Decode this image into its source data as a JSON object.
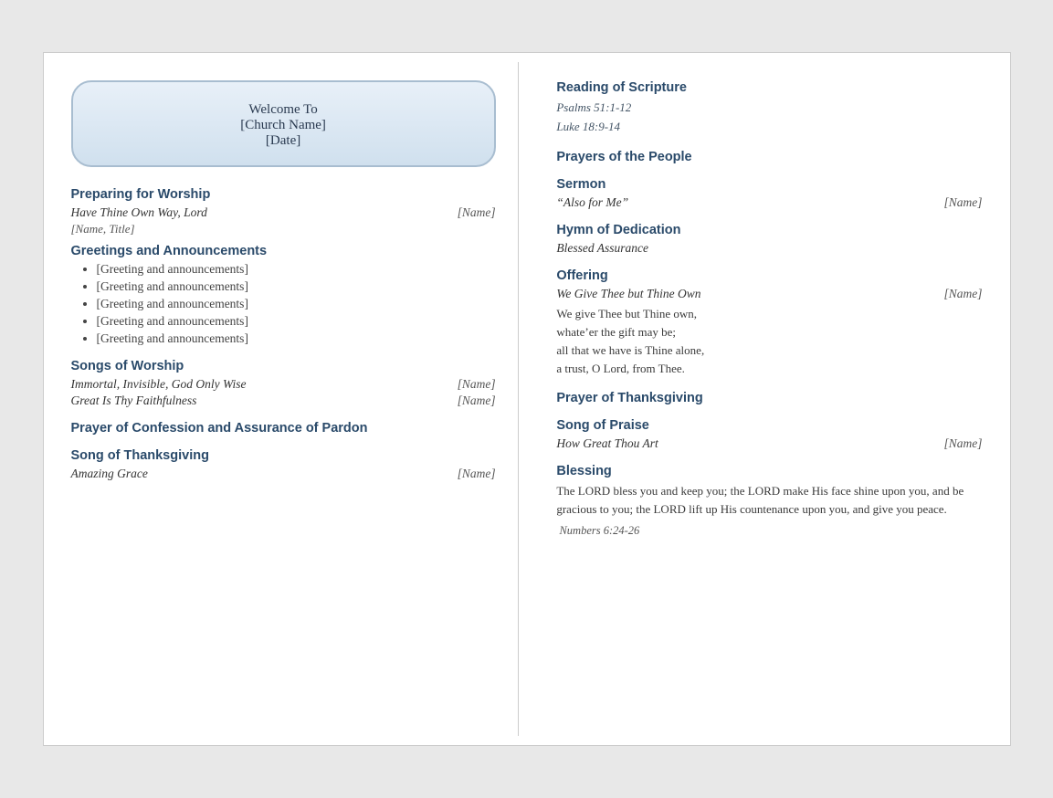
{
  "welcome": {
    "line1": "Welcome To",
    "line2": "[Church Name]",
    "line3": "[Date]"
  },
  "left": {
    "sections": [
      {
        "id": "preparing",
        "title": "Preparing for Worship",
        "items": [
          {
            "song": "Have Thine Own Way, Lord",
            "name": "[Name]"
          }
        ],
        "subtitle": "[Name, Title]"
      },
      {
        "id": "greetings",
        "title": "Greetings and Announcements",
        "bullets": [
          "[Greeting and announcements]",
          "[Greeting and announcements]",
          "[Greeting and announcements]",
          "[Greeting and announcements]",
          "[Greeting and announcements]"
        ]
      },
      {
        "id": "songs",
        "title": "Songs of Worship",
        "items": [
          {
            "song": "Immortal, Invisible, God Only Wise",
            "name": "[Name]"
          },
          {
            "song": "Great Is Thy Faithfulness",
            "name": "[Name]"
          }
        ]
      },
      {
        "id": "confession",
        "title": "Prayer of Confession and Assurance of Pardon"
      },
      {
        "id": "song-thanksgiving",
        "title": "Song of Thanksgiving",
        "items": [
          {
            "song": "Amazing Grace",
            "name": "[Name]"
          }
        ]
      }
    ]
  },
  "right": {
    "sections": [
      {
        "id": "reading",
        "title": "Reading of Scripture",
        "scriptures": [
          "Psalms 51:1-12",
          "Luke 18:9-14"
        ]
      },
      {
        "id": "prayers",
        "title": "Prayers of the People"
      },
      {
        "id": "sermon",
        "title": "Sermon",
        "items": [
          {
            "song": "“Also for Me”",
            "name": "[Name]"
          }
        ]
      },
      {
        "id": "hymn",
        "title": "Hymn of Dedication",
        "items": [
          {
            "song": "Blessed Assurance",
            "name": ""
          }
        ]
      },
      {
        "id": "offering",
        "title": "Offering",
        "items": [
          {
            "song": "We Give Thee but Thine Own",
            "name": "[Name]"
          }
        ],
        "verse": [
          "We give Thee but Thine own,",
          "whate’er the gift may be;",
          "all that we have is Thine alone,",
          "a trust, O Lord, from Thee."
        ]
      },
      {
        "id": "prayer-thanksgiving",
        "title": "Prayer of Thanksgiving"
      },
      {
        "id": "song-praise",
        "title": "Song of Praise",
        "items": [
          {
            "song": "How Great Thou Art",
            "name": "[Name]"
          }
        ]
      },
      {
        "id": "blessing",
        "title": "Blessing",
        "body": "The LORD bless you and keep you; the LORD make His face shine upon you, and be gracious to you; the LORD lift up His countenance upon you, and give you peace.",
        "reference": "Numbers 6:24-26"
      }
    ]
  }
}
